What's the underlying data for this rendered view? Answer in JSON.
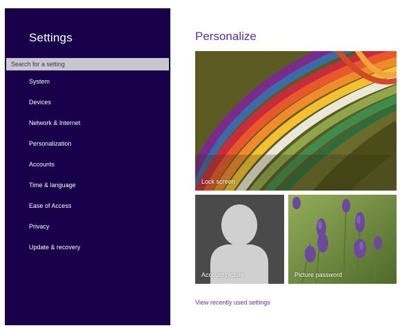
{
  "sidebar": {
    "title": "Settings",
    "search_placeholder": "Search for a setting",
    "items": [
      {
        "label": "System"
      },
      {
        "label": "Devices"
      },
      {
        "label": "Network & Internet"
      },
      {
        "label": "Personalization"
      },
      {
        "label": "Accounts"
      },
      {
        "label": "Time & language"
      },
      {
        "label": "Ease of Access"
      },
      {
        "label": "Privacy"
      },
      {
        "label": "Update & recovery"
      }
    ]
  },
  "main": {
    "title": "Personalize",
    "tiles": {
      "lock_screen": "Lock screen",
      "account_picture": "Account picture",
      "picture_password": "Picture password"
    },
    "recent_link": "View recently used settings"
  },
  "colors": {
    "sidebar_bg": "#18004a",
    "accent": "#5b2fa3"
  }
}
